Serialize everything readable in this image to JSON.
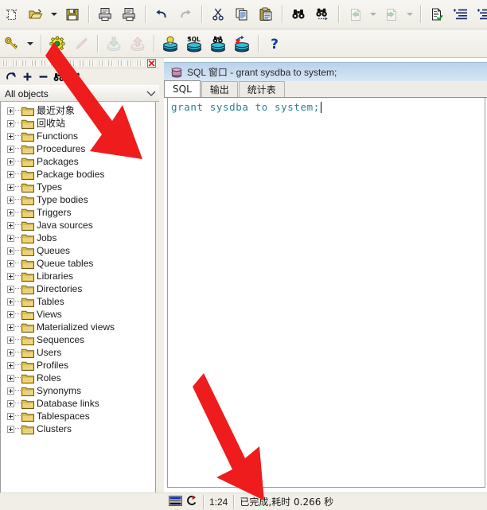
{
  "toolbar_top": {
    "items": [
      {
        "name": "new-window-button",
        "icon": "new-document-icon",
        "enabled": true
      },
      {
        "name": "open-button",
        "icon": "open-folder-icon",
        "enabled": true
      },
      {
        "name": "open-dropdown-button",
        "icon": "chevron-down-icon",
        "enabled": true
      },
      {
        "name": "save-button",
        "icon": "floppy-save-icon",
        "enabled": true
      },
      {
        "name": "print-button",
        "icon": "printer-icon",
        "enabled": true
      },
      {
        "name": "print-preview-button",
        "icon": "print-preview-icon",
        "enabled": true
      },
      {
        "name": "undo-button",
        "icon": "undo-arrow-icon",
        "enabled": true
      },
      {
        "name": "redo-button",
        "icon": "redo-arrow-icon",
        "enabled": false
      },
      {
        "name": "cut-button",
        "icon": "scissors-icon",
        "enabled": true
      },
      {
        "name": "copy-button",
        "icon": "copy-pages-icon",
        "enabled": true
      },
      {
        "name": "paste-button",
        "icon": "clipboard-paste-icon",
        "enabled": true
      },
      {
        "name": "find-button",
        "icon": "binoculars-icon",
        "enabled": true
      },
      {
        "name": "find-next-button",
        "icon": "binoculars-next-icon",
        "enabled": true
      },
      {
        "name": "previous-button",
        "icon": "green-left-arrow-icon",
        "enabled": false
      },
      {
        "name": "previous-dropdown-button",
        "icon": "chevron-down-icon",
        "enabled": false
      },
      {
        "name": "next-button",
        "icon": "green-right-arrow-icon",
        "enabled": false
      },
      {
        "name": "next-dropdown-button",
        "icon": "chevron-down-icon",
        "enabled": false
      },
      {
        "name": "check-syntax-button",
        "icon": "document-check-icon",
        "enabled": true
      },
      {
        "name": "indent-button",
        "icon": "indent-increase-icon",
        "enabled": true
      },
      {
        "name": "outdent-button",
        "icon": "indent-decrease-icon",
        "enabled": true
      }
    ]
  },
  "toolbar_second": {
    "items": [
      {
        "name": "login-button",
        "icon": "yellow-key-icon",
        "enabled": true
      },
      {
        "name": "login-dropdown-button",
        "icon": "chevron-down-icon",
        "enabled": true
      },
      {
        "name": "execute-button",
        "icon": "green-gear-icon",
        "enabled": true,
        "highlighted": true
      },
      {
        "name": "break-button",
        "icon": "red-pencil-icon",
        "enabled": false
      },
      {
        "name": "import-button",
        "icon": "import-down-icon",
        "enabled": false
      },
      {
        "name": "export-button",
        "icon": "export-up-icon",
        "enabled": false
      },
      {
        "name": "session-button",
        "icon": "db-bulb-icon",
        "enabled": true
      },
      {
        "name": "sql-db-button",
        "icon": "db-sql-icon",
        "enabled": true
      },
      {
        "name": "find-db-object-button",
        "icon": "db-binoculars-icon",
        "enabled": true
      },
      {
        "name": "rollback-db-button",
        "icon": "db-rollback-icon",
        "enabled": true
      },
      {
        "name": "help-button",
        "icon": "question-mark-icon",
        "enabled": true
      }
    ]
  },
  "browser_panel": {
    "close_icon": "close-panel-icon",
    "tools": [
      {
        "name": "refresh-tree-button",
        "icon": "refresh-arrow-icon"
      },
      {
        "name": "expand-all-button",
        "icon": "plus-icon"
      },
      {
        "name": "collapse-all-button",
        "icon": "minus-icon"
      },
      {
        "name": "find-object-button",
        "icon": "binoculars-icon"
      },
      {
        "name": "customize-button",
        "icon": "pin-wrench-icon"
      }
    ],
    "filter": {
      "selected": "All objects",
      "chevron_icon": "chevron-down-icon"
    },
    "tree_items": [
      {
        "label": "最近对象",
        "cjk": true
      },
      {
        "label": "回收站",
        "cjk": true
      },
      {
        "label": "Functions",
        "cjk": false
      },
      {
        "label": "Procedures",
        "cjk": false
      },
      {
        "label": "Packages",
        "cjk": false
      },
      {
        "label": "Package bodies",
        "cjk": false
      },
      {
        "label": "Types",
        "cjk": false
      },
      {
        "label": "Type bodies",
        "cjk": false
      },
      {
        "label": "Triggers",
        "cjk": false
      },
      {
        "label": "Java sources",
        "cjk": false
      },
      {
        "label": "Jobs",
        "cjk": false
      },
      {
        "label": "Queues",
        "cjk": false
      },
      {
        "label": "Queue tables",
        "cjk": false
      },
      {
        "label": "Libraries",
        "cjk": false
      },
      {
        "label": "Directories",
        "cjk": false
      },
      {
        "label": "Tables",
        "cjk": false
      },
      {
        "label": "Views",
        "cjk": false
      },
      {
        "label": "Materialized views",
        "cjk": false
      },
      {
        "label": "Sequences",
        "cjk": false
      },
      {
        "label": "Users",
        "cjk": false
      },
      {
        "label": "Profiles",
        "cjk": false
      },
      {
        "label": "Roles",
        "cjk": false
      },
      {
        "label": "Synonyms",
        "cjk": false
      },
      {
        "label": "Database links",
        "cjk": false
      },
      {
        "label": "Tablespaces",
        "cjk": false
      },
      {
        "label": "Clusters",
        "cjk": false
      }
    ]
  },
  "sql_window": {
    "icon": "sql-window-db-icon",
    "title_prefix": "SQL ",
    "title_cjk": "窗口",
    "title_suffix": " - grant sysdba to system;",
    "tabs": [
      {
        "label": "SQL",
        "active": true,
        "name": "tab-sql"
      },
      {
        "label": "输出",
        "active": false,
        "name": "tab-output"
      },
      {
        "label": "统计表",
        "active": false,
        "name": "tab-statistics"
      }
    ],
    "editor": {
      "text": "grant sysdba to system;",
      "text_color": "#2c7f91"
    }
  },
  "status_bar": {
    "stripe_icon": "window-stripe-icon",
    "refresh_icon": "red-refresh-icon",
    "position": "1:24",
    "message": "已完成,耗时 0.266 秒"
  },
  "annotations": {
    "arrow_color": "#ee1c1c",
    "arrows": [
      {
        "name": "arrow-pointing-to-execute-button",
        "target": "execute-button"
      },
      {
        "name": "arrow-pointing-to-status-message",
        "target": "status-message"
      }
    ]
  }
}
